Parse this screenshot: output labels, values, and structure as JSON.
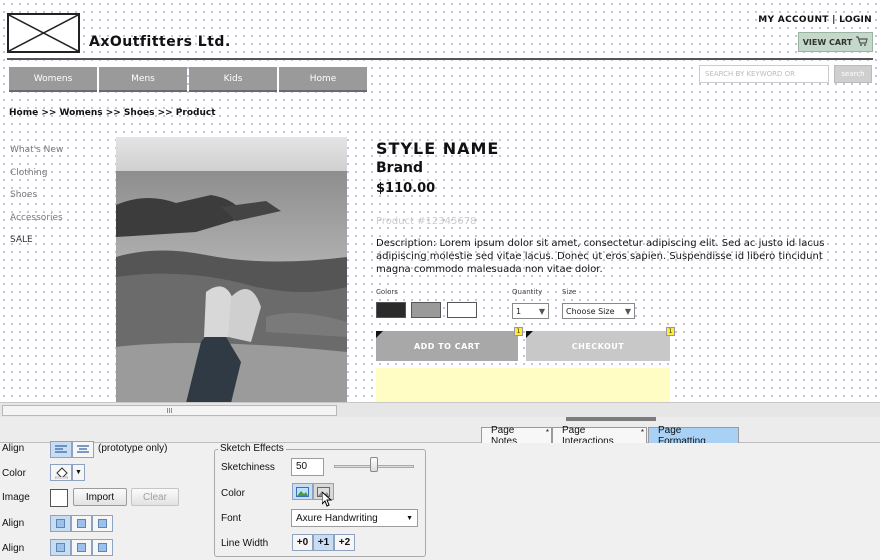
{
  "header": {
    "brand_name": "AxOutfitters Ltd.",
    "account_links": "MY ACCOUNT | LOGIN",
    "view_cart": "VIEW CART",
    "search_placeholder": "SEARCH BY KEYWORD OR",
    "search_button": "search"
  },
  "nav": [
    "Womens",
    "Mens",
    "Kids",
    "Home"
  ],
  "breadcrumb": "Home >> Womens >> Shoes >> Product",
  "sidenav": [
    "What's New",
    "Clothing",
    "Shoes",
    "Accessories",
    "SALE"
  ],
  "product": {
    "style_name": "STYLE NAME",
    "brand": "Brand",
    "price": "$110.00",
    "product_no": "Product #12345678",
    "description": "Description: Lorem ipsum dolor sit amet, consectetur adipiscing elit. Sed ac justo id lacus adipiscing molestie sed vitae lacus. Donec ut eros sapien. Suspendisse id libero tincidunt magna commodo malesuada non vitae dolor.",
    "colors_label": "Colors",
    "swatch_colors": [
      "#2b2b2b",
      "#9a9a9a",
      "#ffffff"
    ],
    "quantity_label": "Quantity",
    "quantity_value": "1",
    "size_label": "Size",
    "size_value": "Choose Size",
    "add_to_cart": "ADD TO CART",
    "checkout": "CHECKOUT",
    "note_badge": "1"
  },
  "scroll_grip": "III",
  "tabs": [
    "Page Notes",
    "Page Interactions",
    "Page Formatting"
  ],
  "active_tab": "Page Formatting",
  "formatting": {
    "align_label": "Align",
    "prototype_only": "(prototype only)",
    "color_label": "Color",
    "image_label": "Image",
    "import_button": "Import",
    "clear_button": "Clear",
    "align2_label": "Align",
    "align3_label": "Align"
  },
  "sketch_effects": {
    "legend": "Sketch Effects",
    "sketchiness_label": "Sketchiness",
    "sketchiness_value": "50",
    "sketchiness_level": 0.5,
    "color_label": "Color",
    "font_label": "Font",
    "font_value": "Axure Handwriting",
    "line_width_label": "Line Width",
    "line_width_options": [
      "+0",
      "+1",
      "+2"
    ],
    "line_width_selected": "+1"
  },
  "colors": {
    "active_tab": "#a9d1f5",
    "view_cart_bg": "#c4d9c9",
    "nav_bg": "#9a9a9a",
    "note_area": "#fffdc4",
    "canvas_dots": "#8a8fc4"
  }
}
